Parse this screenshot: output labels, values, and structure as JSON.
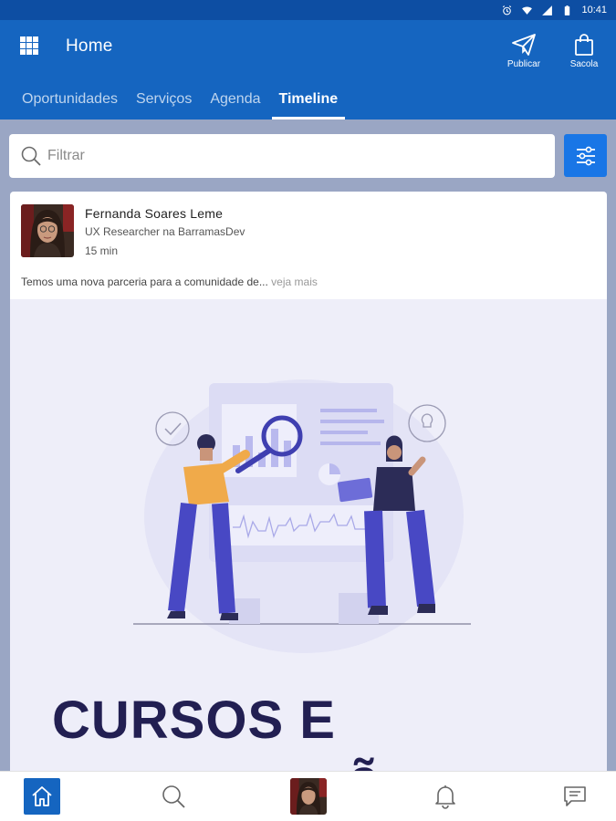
{
  "status_bar": {
    "time": "10:41",
    "icons": [
      "alarm-icon",
      "wifi-icon",
      "signal-icon",
      "battery-icon"
    ]
  },
  "app_bar": {
    "title": "Home",
    "menu_icon": "apps-grid-icon",
    "actions": [
      {
        "label": "Publicar",
        "icon": "paper-plane-icon"
      },
      {
        "label": "Sacola",
        "icon": "shopping-bag-icon"
      }
    ],
    "tabs": [
      {
        "label": "Oportunidades",
        "active": false
      },
      {
        "label": "Serviços",
        "active": false
      },
      {
        "label": "Agenda",
        "active": false
      },
      {
        "label": "Timeline",
        "active": true
      }
    ]
  },
  "search": {
    "placeholder": "Filtrar",
    "value": "",
    "filter_icon": "sliders-icon"
  },
  "post": {
    "author": "Fernanda Soares Leme",
    "role": "UX Researcher na BarramasDev",
    "time": "15 min",
    "text": "Temos uma nova parceria para a comunidade de...",
    "see_more": "veja mais",
    "image_heading": "CURSOS E",
    "image_heading_partial": "ã"
  },
  "bottom_nav": {
    "items": [
      {
        "name": "home",
        "icon": "home-icon",
        "active": true
      },
      {
        "name": "search",
        "icon": "search-icon",
        "active": false
      },
      {
        "name": "profile",
        "icon": "avatar",
        "active": false
      },
      {
        "name": "notifications",
        "icon": "bell-icon",
        "active": false
      },
      {
        "name": "messages",
        "icon": "chat-icon",
        "active": false
      }
    ]
  },
  "colors": {
    "status_bar": "#0d4ea3",
    "app_bar": "#1565c0",
    "page_background": "#9aa6c4",
    "filter_button": "#1976e6",
    "illustration_background": "#eeeef9",
    "heading_text": "#221f52"
  }
}
